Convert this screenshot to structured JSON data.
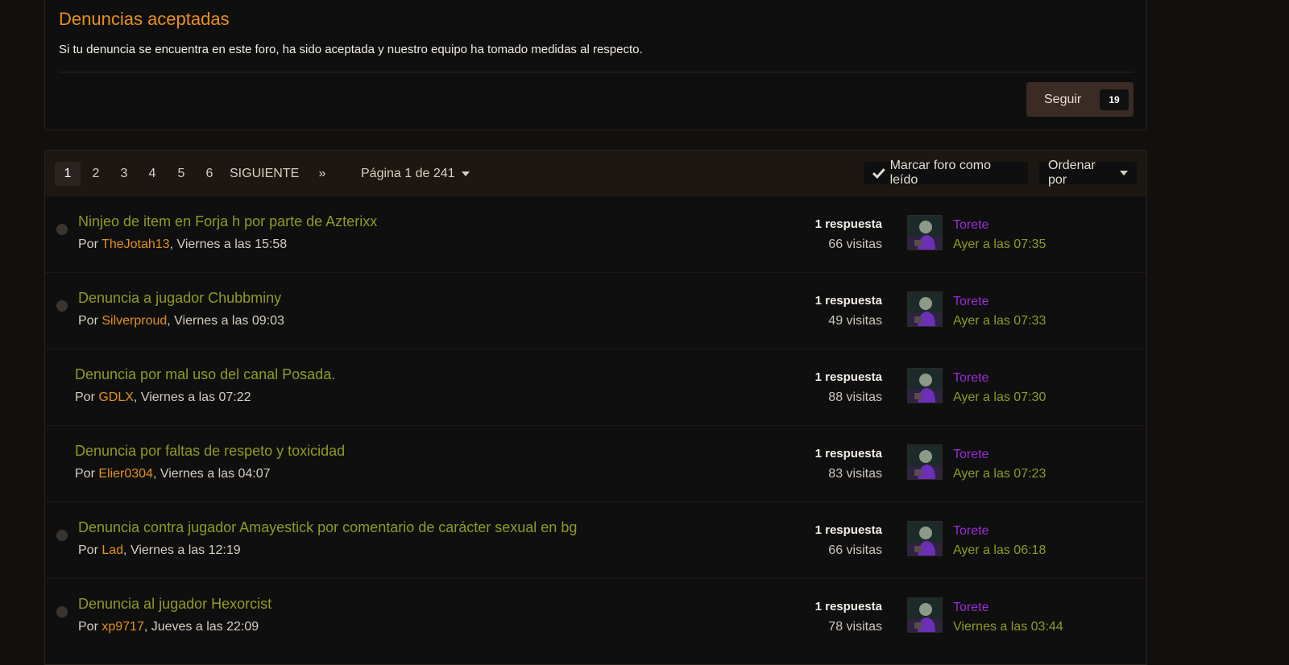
{
  "forum": {
    "title": "Denuncias aceptadas",
    "description": "Si tu denuncia se encuentra en este foro, ha sido aceptada y nuestro equipo ha tomado medidas al respecto.",
    "follow_label": "Seguir",
    "follow_count": "19"
  },
  "pagination": {
    "pages": [
      "1",
      "2",
      "3",
      "4",
      "5",
      "6"
    ],
    "active_page": "1",
    "next_label": "SIGUIENTE",
    "last_label": "»",
    "page_info": "Página 1 de 241"
  },
  "toolbar": {
    "mark_read_label": "Marcar foro como leído",
    "sort_label": "Ordenar por"
  },
  "by_prefix": "Por ",
  "topics": [
    {
      "title": "Ninjeo de item en Forja h por parte de Azterixx",
      "author": "TheJotah13",
      "date": ", Viernes a las 15:58",
      "replies": "1 respuesta",
      "views": "66 visitas",
      "last_user": "Torete",
      "last_time": "Ayer a las 07:35",
      "unread_dot": true
    },
    {
      "title": "Denuncia a jugador Chubbminy",
      "author": "Silverproud",
      "date": ", Viernes a las 09:03",
      "replies": "1 respuesta",
      "views": "49 visitas",
      "last_user": "Torete",
      "last_time": "Ayer a las 07:33",
      "unread_dot": true
    },
    {
      "title": "Denuncia por mal uso del canal Posada.",
      "author": "GDLX",
      "date": ", Viernes a las 07:22",
      "replies": "1 respuesta",
      "views": "88 visitas",
      "last_user": "Torete",
      "last_time": "Ayer a las 07:30",
      "unread_dot": false
    },
    {
      "title": "Denuncia por faltas de respeto y toxicidad",
      "author": "Elier0304",
      "date": ", Viernes a las 04:07",
      "replies": "1 respuesta",
      "views": "83 visitas",
      "last_user": "Torete",
      "last_time": "Ayer a las 07:23",
      "unread_dot": false
    },
    {
      "title": "Denuncia contra jugador Amayestick por comentario de carácter sexual en bg",
      "author": "Lad",
      "date": ", Viernes a las 12:19",
      "replies": "1 respuesta",
      "views": "66 visitas",
      "last_user": "Torete",
      "last_time": "Ayer a las 06:18",
      "unread_dot": true
    },
    {
      "title": "Denuncia al jugador Hexorcist",
      "author": "xp9717",
      "date": ", Jueves a las 22:09",
      "replies": "1 respuesta",
      "views": "78 visitas",
      "last_user": "Torete",
      "last_time": "Viernes a las 03:44",
      "unread_dot": true
    }
  ]
}
